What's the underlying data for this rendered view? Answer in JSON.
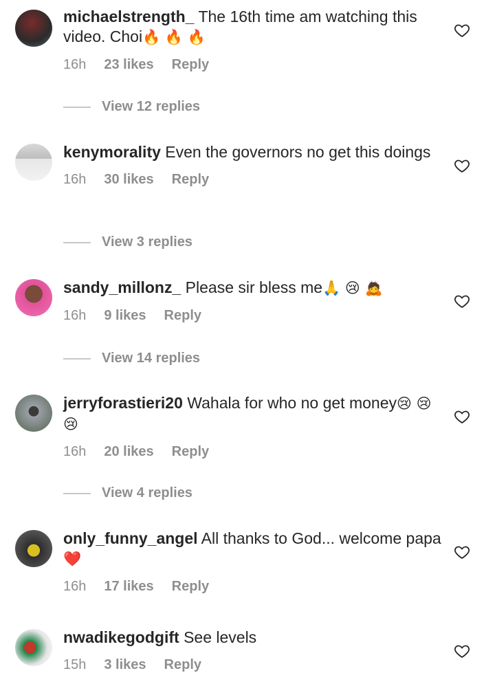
{
  "comments": [
    {
      "username": "michaelstrength_",
      "text": "The 16th time am watching this video. Choi",
      "emoji": "🔥 🔥 🔥",
      "time": "16h",
      "likes": "23 likes",
      "reply": "Reply",
      "view_replies": "View 12 replies"
    },
    {
      "username": "kenymorality",
      "text": "Even the governors no get this doings",
      "emoji": "",
      "time": "16h",
      "likes": "30 likes",
      "reply": "Reply",
      "view_replies": "View 3 replies"
    },
    {
      "username": "sandy_millonz_",
      "text": "Please sir bless me",
      "emoji": "🙏 😢 🙇",
      "time": "16h",
      "likes": "9 likes",
      "reply": "Reply",
      "view_replies": "View 14 replies"
    },
    {
      "username": "jerryforastieri20",
      "text": "Wahala for who no get money",
      "emoji": "😢 😢 😢",
      "time": "16h",
      "likes": "20 likes",
      "reply": "Reply",
      "view_replies": "View 4 replies"
    },
    {
      "username": "only_funny_angel",
      "text": "All thanks to God... welcome papa",
      "emoji": "❤️",
      "time": "16h",
      "likes": "17 likes",
      "reply": "Reply",
      "view_replies": ""
    },
    {
      "username": "nwadikegodgift",
      "text": "See levels",
      "emoji": "",
      "time": "15h",
      "likes": "3 likes",
      "reply": "Reply",
      "view_replies": ""
    }
  ],
  "colors": {
    "text": "#262626",
    "muted": "#8e8e8e",
    "divider": "#c7c7c7"
  }
}
